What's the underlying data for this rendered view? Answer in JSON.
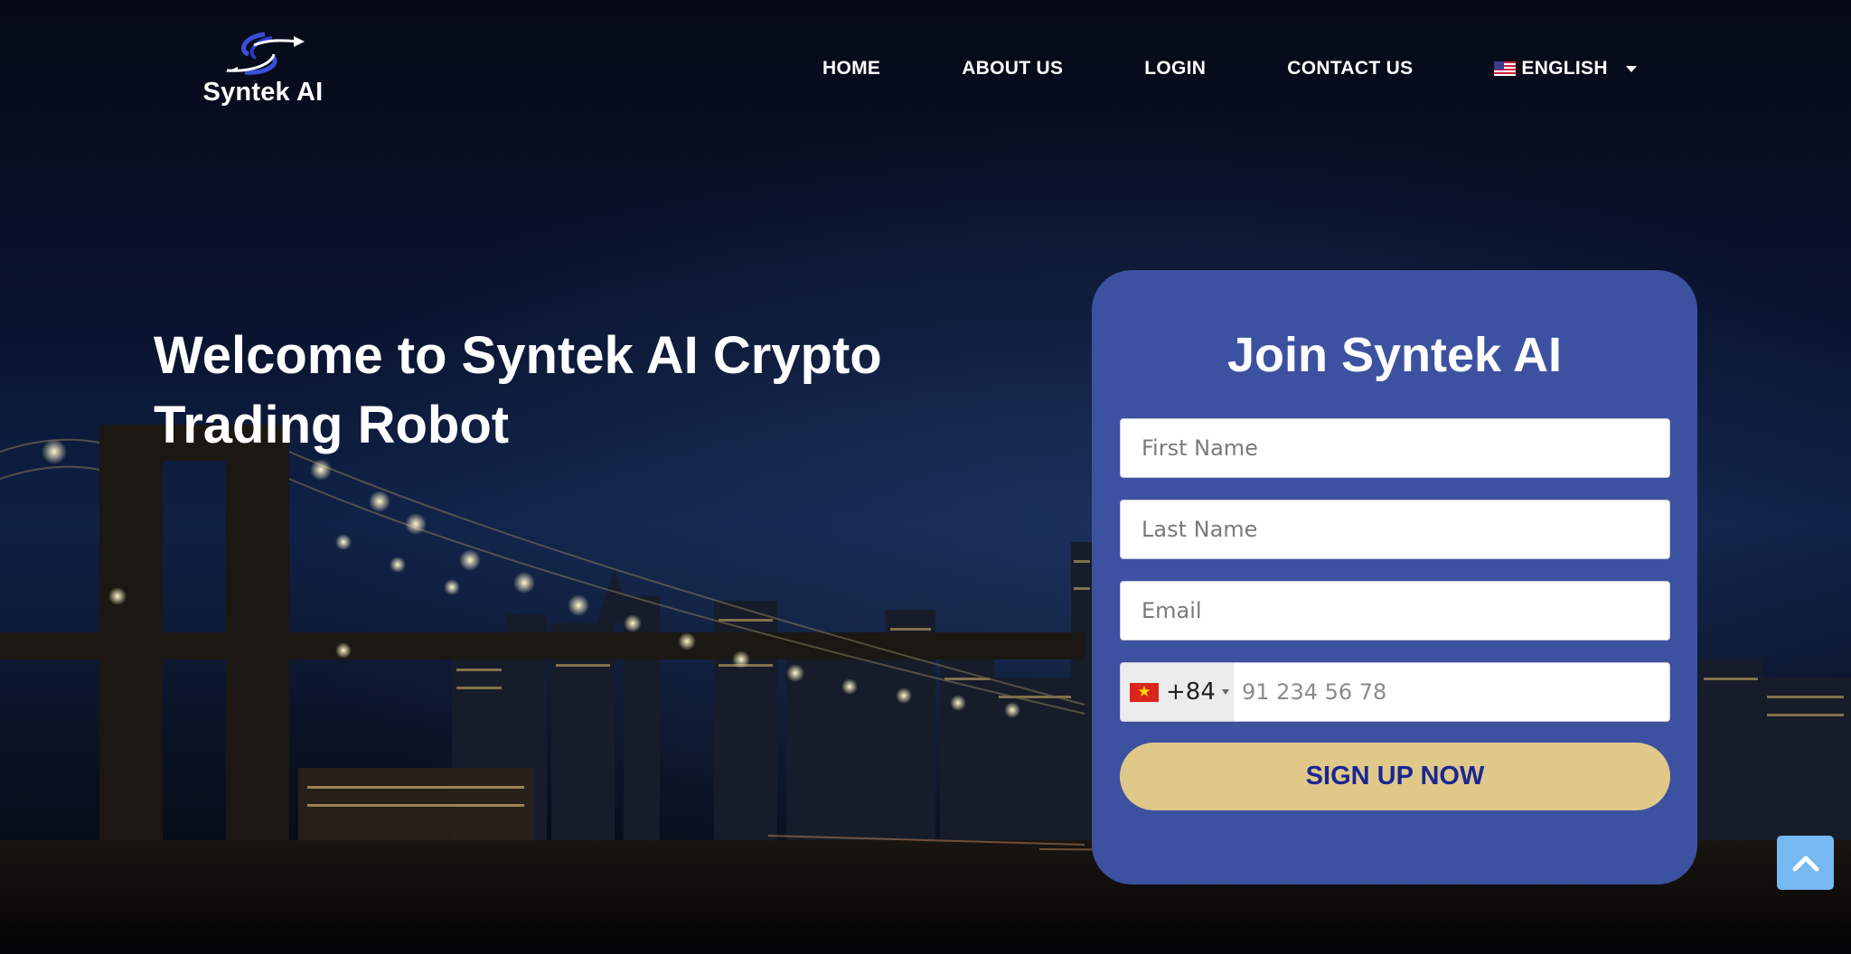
{
  "brand": {
    "name": "Syntek AI"
  },
  "nav": {
    "items": [
      "HOME",
      "ABOUT US",
      "LOGIN",
      "CONTACT US"
    ],
    "language": "ENGLISH",
    "language_icon": "us-flag-icon"
  },
  "hero": {
    "title_line1": "Welcome to Syntek AI Crypto",
    "title_line2": "Trading Robot"
  },
  "form": {
    "title": "Join Syntek AI",
    "first_name_placeholder": "First Name",
    "last_name_placeholder": "Last Name",
    "email_placeholder": "Email",
    "country_code": "+84",
    "country_flag_icon": "vietnam-flag-icon",
    "phone_placeholder": "91 234 56 78",
    "submit_label": "SIGN UP NOW"
  },
  "colors": {
    "card_bg": "#3d51a1",
    "button_bg": "#dfc88a",
    "button_text": "#1a2791",
    "scroll_top_bg": "#76b8f2"
  }
}
